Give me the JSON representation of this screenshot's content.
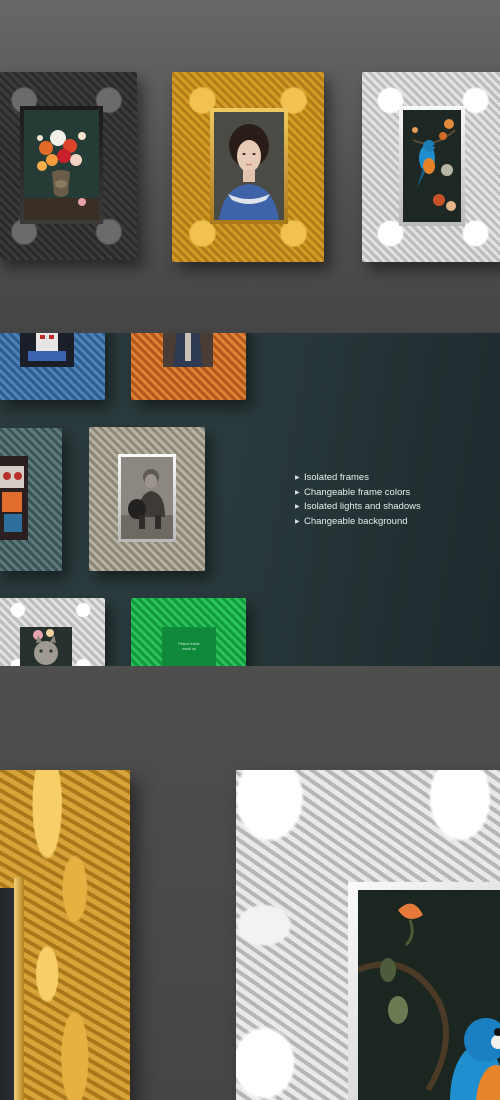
{
  "features_panel": {
    "items": [
      "Isolated frames",
      "Changeable frame colors",
      "Isolated lights and shadows",
      "Changeable background"
    ]
  },
  "green_frame_caption": {
    "line1": "Picture frame",
    "line2": "mock up"
  },
  "icons": {
    "bullet": "triangle-bullet-icon"
  },
  "colors": {
    "gold_frame": "#d49c27",
    "silver_frame": "#e2e2e2",
    "black_frame": "#3b3b3b",
    "blue_frame": "#4f84bb",
    "orange_frame": "#de8236",
    "teal_frame": "#5e7a7c",
    "champagne_frame": "#b7b1a2",
    "green_frame": "#2cc25b",
    "dark_teal_background": "#2b3b3d",
    "grey_background": "#4f4f4f"
  }
}
